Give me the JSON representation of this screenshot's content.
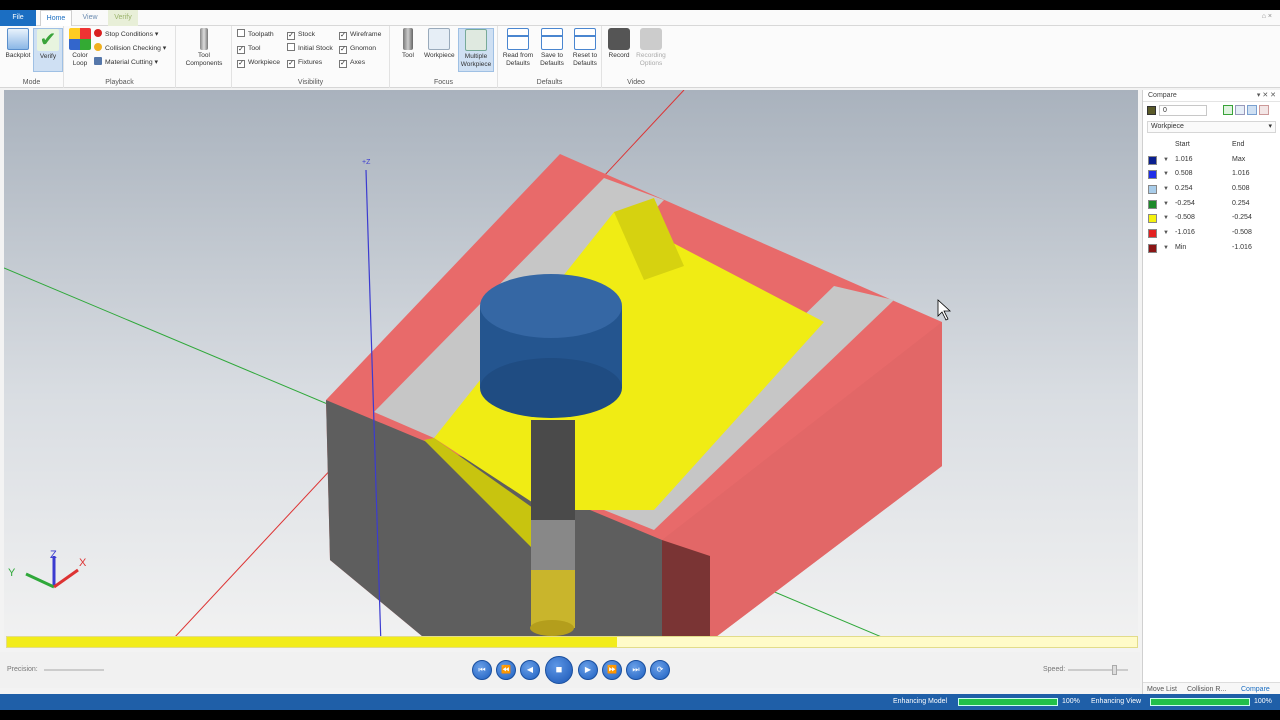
{
  "tabs": {
    "file": "File",
    "home": "Home",
    "view": "View",
    "verify": "Verify"
  },
  "window_controls": "⌂  ×",
  "ribbon": {
    "mode": {
      "backplot": "Backplot",
      "verify": "Verify",
      "label": "Mode"
    },
    "playback": {
      "color_loop": "Color Loop",
      "stop_conditions": "Stop Conditions",
      "collision_checking": "Collision Checking",
      "material_cutting": "Material Cutting",
      "label": "Playback"
    },
    "tool_components": "Tool Components",
    "visibility": {
      "toolpath": "Toolpath",
      "stock": "Stock",
      "wireframe": "Wireframe",
      "tool": "Tool",
      "initial_stock": "Initial Stock",
      "gnomon": "Gnomon",
      "workpiece": "Workpiece",
      "fixtures": "Fixtures",
      "axes": "Axes",
      "label": "Visibility"
    },
    "focus": {
      "tool": "Tool",
      "workpiece": "Workpiece",
      "multiple_workpiece": "Multiple Workpiece",
      "label": "Focus"
    },
    "defaults": {
      "read_from": "Read from Defaults",
      "save_to": "Save to Defaults",
      "reset_to": "Reset to Defaults",
      "label": "Defaults"
    },
    "video": {
      "record": "Record",
      "recording_options": "Recording Options",
      "label": "Video"
    }
  },
  "viewport": {
    "axis_z_label": "+Z",
    "gnomon": {
      "x": "X",
      "y": "Y",
      "z": "Z"
    }
  },
  "playback": {
    "precision_label": "Precision:",
    "speed_label": "Speed:",
    "progress_fraction": 0.54,
    "buttons": [
      "⏮",
      "⏪",
      "◀",
      "■",
      "▶",
      "⏩",
      "⏭",
      "⟳"
    ]
  },
  "compare": {
    "title": "Compare",
    "header_controls": "▾ ✕ ✕",
    "tolerance_value": "0",
    "target": "Workpiece",
    "columns": {
      "start": "Start",
      "end": "End"
    },
    "rows": [
      {
        "color": "#0a1f8f",
        "start": "1.016",
        "end": "Max"
      },
      {
        "color": "#1f2ee8",
        "start": "0.508",
        "end": "1.016"
      },
      {
        "color": "#a9cdea",
        "start": "0.254",
        "end": "0.508"
      },
      {
        "color": "#1d8a2a",
        "start": "-0.254",
        "end": "0.254"
      },
      {
        "color": "#f5f20e",
        "start": "-0.508",
        "end": "-0.254"
      },
      {
        "color": "#e32121",
        "start": "-1.016",
        "end": "-0.508"
      },
      {
        "color": "#8a1515",
        "start": "Min",
        "end": "-1.016"
      }
    ],
    "bottom_tabs": {
      "move_list": "Move List",
      "collision": "Collision R...",
      "compare": "Compare"
    }
  },
  "status": {
    "enhancing_model": "Enhancing Model",
    "enhancing_model_pct": "100%",
    "enhancing_model_fraction": 1.0,
    "enhancing_view": "Enhancing View",
    "enhancing_view_pct": "100%",
    "enhancing_view_fraction": 1.0
  }
}
